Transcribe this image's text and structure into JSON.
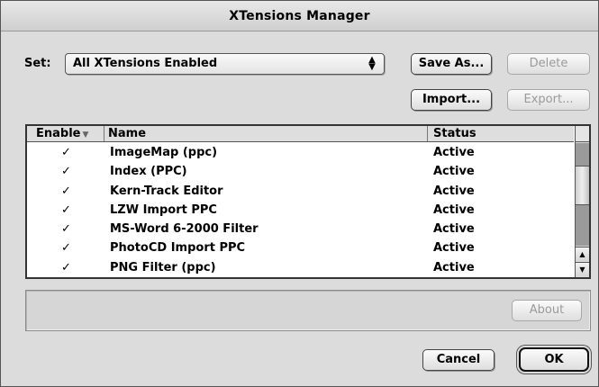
{
  "window": {
    "title": "XTensions Manager"
  },
  "set": {
    "label": "Set:",
    "selected": "All XTensions Enabled",
    "arrow_up": "▲",
    "arrow_down": "▼"
  },
  "buttons": {
    "save_as": "Save As...",
    "delete": "Delete",
    "import": "Import...",
    "export": "Export...",
    "about": "About",
    "cancel": "Cancel",
    "ok": "OK"
  },
  "list": {
    "columns": {
      "enable": "Enable",
      "name": "Name",
      "status": "Status",
      "sort_indicator": "▼"
    },
    "rows": [
      {
        "enabled": "✓",
        "name": "ImageMap (ppc)",
        "status": "Active"
      },
      {
        "enabled": "✓",
        "name": "Index (PPC)",
        "status": "Active"
      },
      {
        "enabled": "✓",
        "name": "Kern-Track Editor",
        "status": "Active"
      },
      {
        "enabled": "✓",
        "name": "LZW Import PPC",
        "status": "Active"
      },
      {
        "enabled": "✓",
        "name": "MS-Word 6-2000 Filter",
        "status": "Active"
      },
      {
        "enabled": "✓",
        "name": "PhotoCD Import PPC",
        "status": "Active"
      },
      {
        "enabled": "✓",
        "name": "PNG Filter (ppc)",
        "status": "Active"
      }
    ],
    "scroll": {
      "up_arrow": "▲",
      "down_arrow": "▼",
      "position_fraction": 0.35
    }
  },
  "colors": {
    "window_bg": "#dcdcdc",
    "disabled_text": "#9a9a9a"
  }
}
